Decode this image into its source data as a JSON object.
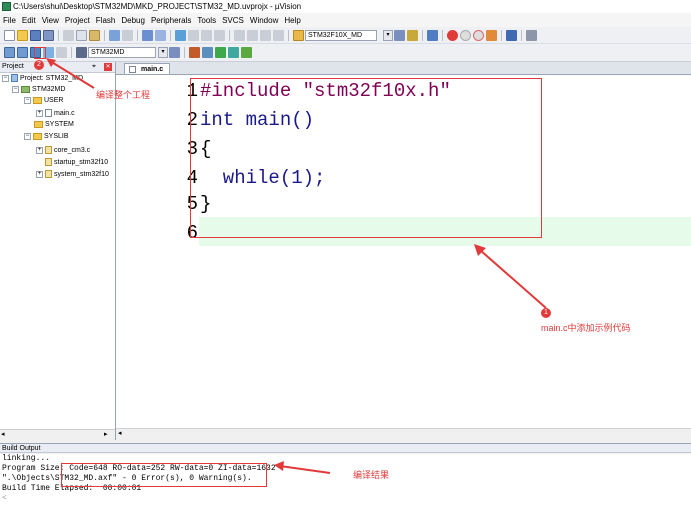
{
  "window": {
    "title": "C:\\Users\\shui\\Desktop\\STM32MD\\MKD_PROJECT\\STM32_MD.uvprojx - µVision"
  },
  "menu": [
    "File",
    "Edit",
    "View",
    "Project",
    "Flash",
    "Debug",
    "Peripherals",
    "Tools",
    "SVCS",
    "Window",
    "Help"
  ],
  "toolbar": {
    "device_combo": "STM32F10X_MD",
    "target_combo": "STM32MD"
  },
  "project_panel": {
    "title": "Project",
    "pin": "⌖",
    "close": "✕",
    "tree": [
      "Project: STM32_MD",
      "STM32MD",
      "USER",
      "main.c",
      "SYSTEM",
      "SYSLIB",
      "core_cm3.c",
      "startup_stm32f10",
      "system_stm32f10"
    ]
  },
  "editor": {
    "tab": "main.c",
    "lines": [
      "#include \"stm32f10x.h\"",
      "int main()",
      "{",
      "  while(1);",
      "}",
      ""
    ],
    "line_numbers": [
      "1",
      "2",
      "3",
      "4",
      "5",
      "6"
    ]
  },
  "build_output": {
    "title": "Build Output",
    "lines": [
      "linking...",
      "Program Size: Code=648 RO-data=252 RW-data=0 ZI-data=1632",
      "\".\\Objects\\STM32_MD.axf\" - 0 Error(s), 0 Warning(s).",
      "Build Time Elapsed:  00:00:01"
    ]
  },
  "annotations": {
    "build_all": "编译整个工程",
    "code_note": "main.c中添加示例代码",
    "result_note": "编译结果",
    "badge1": "1",
    "badge2": "2"
  },
  "colors": {
    "accent_red": "#e23a3a",
    "keyword": "#0000cc",
    "preprocessor": "#7f0055",
    "string": "#1a1a8a",
    "current_line": "#e6fbe9"
  }
}
